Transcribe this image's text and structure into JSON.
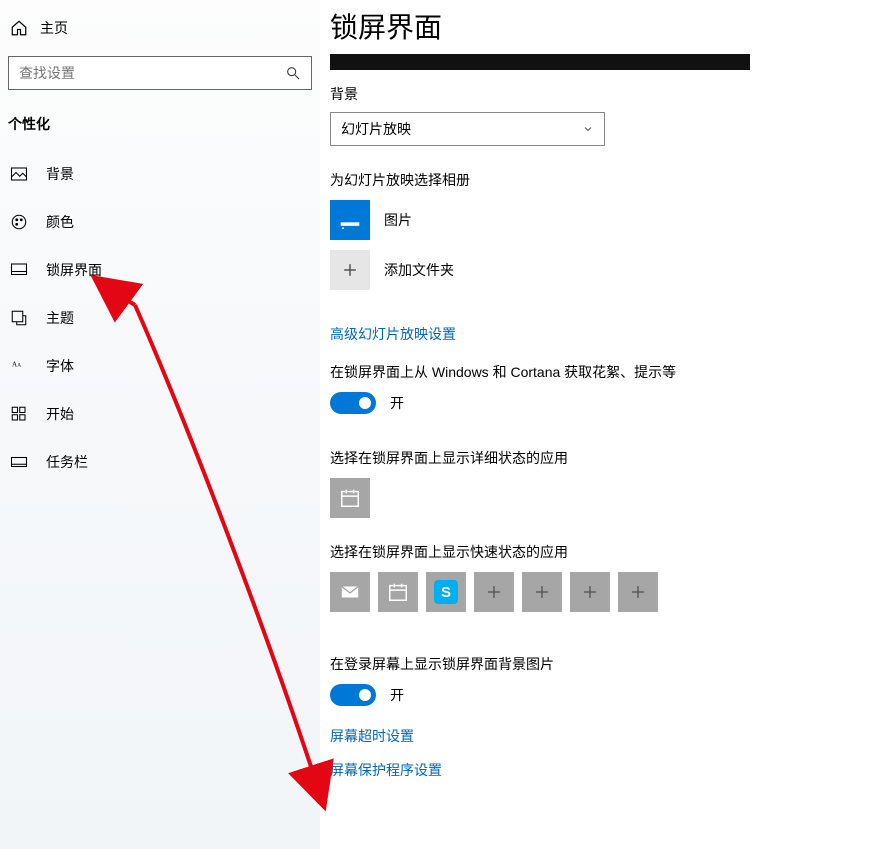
{
  "sidebar": {
    "home": "主页",
    "search_placeholder": "查找设置",
    "section": "个性化",
    "items": [
      {
        "label": "背景"
      },
      {
        "label": "颜色"
      },
      {
        "label": "锁屏界面"
      },
      {
        "label": "主题"
      },
      {
        "label": "字体"
      },
      {
        "label": "开始"
      },
      {
        "label": "任务栏"
      }
    ]
  },
  "main": {
    "title": "锁屏界面",
    "background_label": "背景",
    "background_value": "幻灯片放映",
    "album_label": "为幻灯片放映选择相册",
    "album_pictures": "图片",
    "album_add": "添加文件夹",
    "advanced_link": "高级幻灯片放映设置",
    "windows_cortana_label": "在锁屏界面上从 Windows 和 Cortana 获取花絮、提示等",
    "toggle_on": "开",
    "detailed_app_label": "选择在锁屏界面上显示详细状态的应用",
    "quick_app_label": "选择在锁屏界面上显示快速状态的应用",
    "login_bg_label": "在登录屏幕上显示锁屏界面背景图片",
    "timeout_link": "屏幕超时设置",
    "screensaver_link": "屏幕保护程序设置"
  }
}
